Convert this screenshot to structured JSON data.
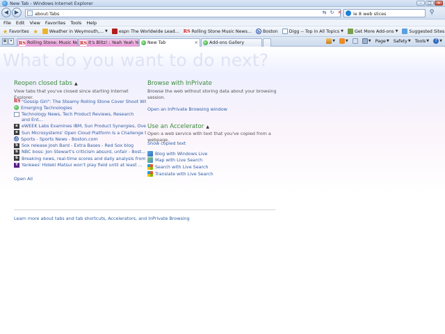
{
  "window": {
    "title": "New Tab - Windows Internet Explorer",
    "minimize": "–",
    "maximize": "□",
    "close": "✕"
  },
  "address": {
    "url": "about:Tabs",
    "search_value": "ie 8 web slices",
    "back": "◀",
    "forward": "▶",
    "refresh": "↻",
    "stop": "✕",
    "go": "⚲",
    "compat": "⇆"
  },
  "menu": [
    {
      "label": "File"
    },
    {
      "label": "Edit"
    },
    {
      "label": "View"
    },
    {
      "label": "Favorites"
    },
    {
      "label": "Tools"
    },
    {
      "label": "Help"
    }
  ],
  "favorites_bar": {
    "favorites_label": "Favorites",
    "items": [
      {
        "label": "Weather in Weymouth,...",
        "icon": "weather-icon"
      },
      {
        "label": "espn The Worldwide Lead...",
        "icon": "espn-icon"
      },
      {
        "label": "Rolling Stone Music News...",
        "icon": "rolling-stone-icon"
      },
      {
        "label": "Boston",
        "icon": "boston-icon"
      },
      {
        "label": "Digg -- Top in All Topics",
        "icon": "digg-icon"
      },
      {
        "label": "Get More Add-ons",
        "icon": "addons-icon"
      },
      {
        "label": "Suggested Sites",
        "icon": "suggested-sites-icon"
      }
    ]
  },
  "tabs": [
    {
      "label": "Rolling Stone: Music News...",
      "style": "pink"
    },
    {
      "label": "It's Blitz! : Yeah Yeah Yeahs...",
      "style": "pink"
    },
    {
      "label": "New Tab",
      "style": "active"
    },
    {
      "label": "Add-ons Gallery",
      "style": "plain"
    }
  ],
  "command_bar": {
    "page": "Page",
    "safety": "Safety",
    "tools": "Tools",
    "help": "?"
  },
  "content": {
    "heading": "What do you want to do next?",
    "reopen": {
      "title": "Reopen closed tabs",
      "description": "View tabs that you've closed since starting Internet Explorer.",
      "items": [
        {
          "label": "\"Gossip Girl\": The Steamy Rolling Stone Cover Shoot Wit...",
          "icon": "rolling-stone-icon"
        },
        {
          "label": "Emerging Technologies",
          "icon": "globe-icon"
        },
        {
          "label": "Technology News, Tech Product Reviews, Research and Ent...",
          "icon": "page-icon"
        },
        {
          "label": "eWEEK Labs Examines IBM, Sun Product Synergies, Overlap",
          "icon": "news-icon"
        },
        {
          "label": "Sun Microsystems' Open Cloud Platform Is a Challenge to...",
          "icon": "news-icon"
        },
        {
          "label": "Sports - Sports News - Boston.com",
          "icon": "boston-icon"
        },
        {
          "label": "Sox release Josh Bard - Extra Bases - Red Sox blog",
          "icon": "news-icon"
        },
        {
          "label": "NBC boss: Jon Stewart's criticism absurd, unfair - Bost...",
          "icon": "news-icon"
        },
        {
          "label": "Breaking news, real-time scores and daily analysis from...",
          "icon": "news-icon"
        },
        {
          "label": "Yankees' Hideki Matsui won't play field until at least ...",
          "icon": "yahoo-icon"
        }
      ],
      "open_all": "Open All"
    },
    "inprivate": {
      "title": "Browse with InPrivate",
      "description": "Browse the web without storing data about your browsing session.",
      "link": "Open an InPrivate Browsing window"
    },
    "accelerator": {
      "title": "Use an Accelerator",
      "description": "Open a web service with text that you've copied from a webpage.",
      "show_copied": "Show copied text",
      "items": [
        {
          "label": "Blog with Windows Live",
          "icon": "blog-icon"
        },
        {
          "label": "Map with Live Search",
          "icon": "map-icon"
        },
        {
          "label": "Search with Live Search",
          "icon": "windows-icon"
        },
        {
          "label": "Translate with Live Search",
          "icon": "windows-icon"
        }
      ]
    },
    "footer_link": "Learn more about tabs and tab shortcuts, Accelerators, and InPrivate Browsing"
  }
}
